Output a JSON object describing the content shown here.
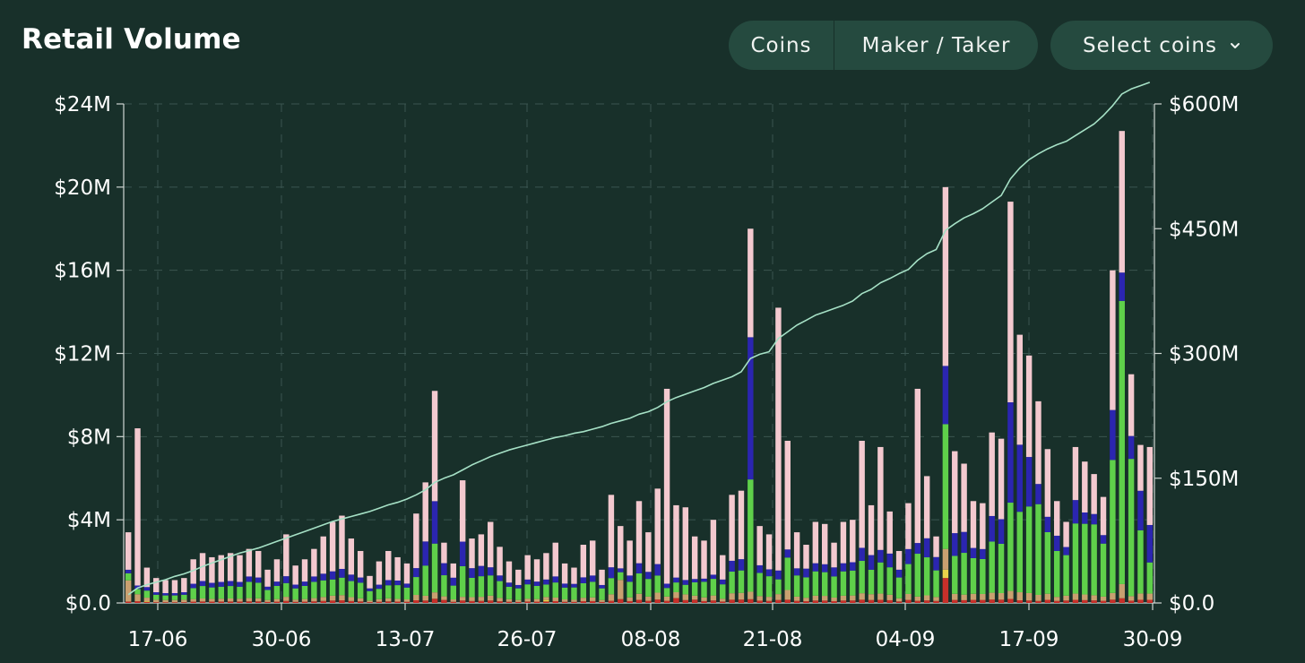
{
  "header": {
    "title": "Retail Volume",
    "toggle": [
      "Coins",
      "Maker / Taker"
    ],
    "select_label": "Select coins",
    "select_icon": "chevron-down-icon"
  },
  "chart_data": {
    "type": "bar",
    "stacked": true,
    "title": "Retail Volume",
    "grid": true,
    "x_ticks": [
      "17-06",
      "30-06",
      "13-07",
      "26-07",
      "08-08",
      "21-08",
      "04-09",
      "17-09",
      "30-09"
    ],
    "y_left": {
      "ticks": [
        "$0.0",
        "$4M",
        "$8M",
        "$12M",
        "$16M",
        "$20M",
        "$24M"
      ],
      "range": [
        0,
        24
      ]
    },
    "y_right": {
      "ticks": [
        "$0.0",
        "$150M",
        "$300M",
        "$450M",
        "$600M"
      ],
      "range": [
        0,
        600
      ]
    },
    "series_colors": [
      "#c8302a",
      "#e8d44a",
      "#c9a070",
      "#5fd04a",
      "#2b25b0",
      "#f3c9cf"
    ],
    "line_color": "#a6e1c6",
    "totals": [
      3.4,
      8.4,
      1.7,
      1.2,
      1.1,
      1.1,
      1.2,
      2.1,
      2.4,
      2.2,
      2.3,
      2.4,
      2.3,
      2.6,
      2.5,
      1.6,
      2.1,
      3.3,
      1.8,
      2.1,
      2.6,
      3.2,
      3.9,
      4.2,
      3.1,
      2.5,
      1.3,
      2.0,
      2.5,
      2.2,
      1.9,
      4.3,
      5.8,
      10.2,
      2.9,
      1.9,
      5.9,
      3.1,
      3.3,
      3.9,
      2.7,
      2.0,
      1.6,
      2.3,
      2.1,
      2.4,
      2.9,
      1.9,
      1.7,
      2.8,
      3.0,
      1.6,
      5.2,
      3.7,
      3.0,
      4.9,
      3.4,
      5.5,
      10.3,
      4.7,
      4.6,
      3.2,
      3.0,
      4.0,
      2.3,
      5.2,
      5.4,
      18.0,
      3.7,
      3.3,
      14.2,
      7.8,
      3.4,
      2.8,
      3.9,
      3.8,
      2.9,
      3.9,
      4.0,
      7.8,
      4.7,
      7.5,
      4.4,
      2.5,
      4.8,
      10.3,
      6.1,
      3.2,
      20.0,
      7.3,
      6.7,
      4.9,
      4.8,
      8.2,
      7.9,
      19.3,
      12.9,
      11.9,
      9.7,
      7.4,
      4.9,
      3.9,
      7.5,
      6.8,
      6.2,
      5.1,
      16.0,
      22.7,
      11.0,
      7.6,
      7.5
    ],
    "cumulative_right": [
      10,
      18,
      22,
      25,
      28,
      32,
      35,
      39,
      44,
      48,
      52,
      56,
      60,
      63,
      66,
      70,
      74,
      78,
      82,
      86,
      90,
      94,
      98,
      101,
      104,
      107,
      110,
      114,
      118,
      121,
      125,
      130,
      136,
      145,
      150,
      154,
      160,
      166,
      171,
      176,
      180,
      184,
      187,
      190,
      193,
      196,
      199,
      201,
      204,
      206,
      209,
      212,
      216,
      219,
      222,
      227,
      230,
      235,
      242,
      247,
      251,
      255,
      259,
      264,
      268,
      272,
      278,
      294,
      299,
      302,
      318,
      326,
      334,
      340,
      346,
      350,
      354,
      358,
      363,
      372,
      377,
      385,
      390,
      396,
      401,
      412,
      420,
      425,
      448,
      456,
      463,
      468,
      474,
      482,
      490,
      510,
      523,
      533,
      540,
      546,
      551,
      555,
      562,
      569,
      576,
      586,
      598,
      612,
      618,
      622,
      626
    ],
    "shares": {
      "red": [
        0.02,
        0.01,
        0.03,
        0.03,
        0.03,
        0.03,
        0.03,
        0.03,
        0.03,
        0.03,
        0.03,
        0.03,
        0.03,
        0.03,
        0.03,
        0.03,
        0.03,
        0.03,
        0.03,
        0.03,
        0.03,
        0.03,
        0.03,
        0.03,
        0.03,
        0.03,
        0.03,
        0.03,
        0.03,
        0.03,
        0.03,
        0.03,
        0.02,
        0.02,
        0.05,
        0.03,
        0.02,
        0.03,
        0.03,
        0.03,
        0.03,
        0.03,
        0.03,
        0.03,
        0.03,
        0.03,
        0.03,
        0.03,
        0.03,
        0.03,
        0.03,
        0.03,
        0.02,
        0.05,
        0.03,
        0.03,
        0.03,
        0.03,
        0.01,
        0.05,
        0.03,
        0.05,
        0.03,
        0.03,
        0.03,
        0.03,
        0.03,
        0.01,
        0.03,
        0.03,
        0.01,
        0.02,
        0.03,
        0.03,
        0.03,
        0.03,
        0.03,
        0.03,
        0.03,
        0.02,
        0.03,
        0.02,
        0.03,
        0.03,
        0.03,
        0.01,
        0.02,
        0.03,
        0.06,
        0.02,
        0.02,
        0.03,
        0.03,
        0.02,
        0.02,
        0.01,
        0.01,
        0.01,
        0.01,
        0.02,
        0.02,
        0.03,
        0.02,
        0.02,
        0.02,
        0.02,
        0.01,
        0.01,
        0.01,
        0.02,
        0.02
      ],
      "yellow": [
        0.0,
        0.0,
        0.02,
        0.0,
        0.0,
        0.0,
        0.0,
        0.0,
        0.0,
        0.0,
        0.0,
        0.0,
        0.0,
        0.0,
        0.0,
        0.0,
        0.0,
        0.0,
        0.0,
        0.0,
        0.0,
        0.0,
        0.0,
        0.0,
        0.0,
        0.0,
        0.0,
        0.0,
        0.0,
        0.0,
        0.0,
        0.0,
        0.0,
        0.0,
        0.0,
        0.0,
        0.0,
        0.0,
        0.0,
        0.0,
        0.0,
        0.0,
        0.0,
        0.0,
        0.0,
        0.03,
        0.0,
        0.0,
        0.0,
        0.0,
        0.0,
        0.0,
        0.0,
        0.0,
        0.0,
        0.0,
        0.0,
        0.0,
        0.0,
        0.0,
        0.0,
        0.0,
        0.0,
        0.0,
        0.0,
        0.0,
        0.0,
        0.0,
        0.0,
        0.0,
        0.0,
        0.0,
        0.0,
        0.0,
        0.0,
        0.0,
        0.0,
        0.0,
        0.0,
        0.0,
        0.0,
        0.0,
        0.0,
        0.0,
        0.0,
        0.0,
        0.0,
        0.0,
        0.02,
        0.0,
        0.0,
        0.0,
        0.0,
        0.0,
        0.0,
        0.0,
        0.0,
        0.0,
        0.0,
        0.0,
        0.0,
        0.0,
        0.0,
        0.0,
        0.0,
        0.0,
        0.0,
        0.0,
        0.0,
        0.0,
        0.0
      ],
      "tan": [
        0.3,
        0.04,
        0.1,
        0.1,
        0.1,
        0.1,
        0.1,
        0.06,
        0.06,
        0.06,
        0.06,
        0.06,
        0.06,
        0.06,
        0.06,
        0.06,
        0.06,
        0.06,
        0.06,
        0.06,
        0.06,
        0.06,
        0.06,
        0.06,
        0.06,
        0.06,
        0.06,
        0.06,
        0.06,
        0.06,
        0.06,
        0.06,
        0.04,
        0.03,
        0.06,
        0.06,
        0.03,
        0.06,
        0.06,
        0.06,
        0.06,
        0.06,
        0.06,
        0.06,
        0.06,
        0.06,
        0.06,
        0.06,
        0.06,
        0.06,
        0.06,
        0.06,
        0.06,
        0.25,
        0.06,
        0.06,
        0.06,
        0.06,
        0.02,
        0.06,
        0.06,
        0.06,
        0.06,
        0.06,
        0.06,
        0.06,
        0.06,
        0.02,
        0.06,
        0.06,
        0.02,
        0.06,
        0.06,
        0.06,
        0.06,
        0.06,
        0.06,
        0.06,
        0.06,
        0.04,
        0.06,
        0.04,
        0.06,
        0.06,
        0.06,
        0.02,
        0.04,
        0.06,
        0.05,
        0.04,
        0.04,
        0.06,
        0.06,
        0.04,
        0.04,
        0.02,
        0.03,
        0.03,
        0.03,
        0.04,
        0.04,
        0.06,
        0.04,
        0.04,
        0.04,
        0.04,
        0.02,
        0.03,
        0.02,
        0.04,
        0.04
      ],
      "green": [
        0.1,
        0.03,
        0.2,
        0.2,
        0.2,
        0.2,
        0.2,
        0.25,
        0.25,
        0.25,
        0.25,
        0.25,
        0.25,
        0.3,
        0.3,
        0.3,
        0.3,
        0.2,
        0.3,
        0.3,
        0.3,
        0.25,
        0.2,
        0.2,
        0.25,
        0.3,
        0.35,
        0.25,
        0.25,
        0.3,
        0.3,
        0.2,
        0.25,
        0.23,
        0.35,
        0.35,
        0.25,
        0.3,
        0.3,
        0.25,
        0.3,
        0.3,
        0.35,
        0.3,
        0.3,
        0.25,
        0.25,
        0.3,
        0.35,
        0.25,
        0.25,
        0.35,
        0.15,
        0.1,
        0.25,
        0.2,
        0.25,
        0.15,
        0.04,
        0.1,
        0.1,
        0.2,
        0.25,
        0.2,
        0.3,
        0.2,
        0.2,
        0.3,
        0.3,
        0.3,
        0.05,
        0.2,
        0.3,
        0.35,
        0.3,
        0.3,
        0.35,
        0.3,
        0.3,
        0.2,
        0.25,
        0.2,
        0.3,
        0.4,
        0.3,
        0.2,
        0.3,
        0.4,
        0.3,
        0.25,
        0.3,
        0.35,
        0.35,
        0.3,
        0.3,
        0.22,
        0.3,
        0.35,
        0.45,
        0.4,
        0.45,
        0.5,
        0.45,
        0.5,
        0.55,
        0.5,
        0.4,
        0.6,
        0.6,
        0.4,
        0.2
      ],
      "blue": [
        0.05,
        0.02,
        0.1,
        0.1,
        0.1,
        0.1,
        0.1,
        0.1,
        0.1,
        0.1,
        0.1,
        0.1,
        0.1,
        0.1,
        0.1,
        0.1,
        0.1,
        0.1,
        0.1,
        0.1,
        0.1,
        0.1,
        0.1,
        0.1,
        0.1,
        0.1,
        0.1,
        0.1,
        0.1,
        0.1,
        0.1,
        0.1,
        0.2,
        0.2,
        0.2,
        0.2,
        0.2,
        0.15,
        0.15,
        0.1,
        0.1,
        0.1,
        0.1,
        0.1,
        0.1,
        0.1,
        0.1,
        0.1,
        0.1,
        0.1,
        0.1,
        0.1,
        0.1,
        0.05,
        0.1,
        0.1,
        0.1,
        0.1,
        0.02,
        0.05,
        0.05,
        0.05,
        0.05,
        0.05,
        0.1,
        0.1,
        0.1,
        0.38,
        0.1,
        0.1,
        0.03,
        0.05,
        0.1,
        0.15,
        0.1,
        0.1,
        0.15,
        0.1,
        0.1,
        0.08,
        0.15,
        0.08,
        0.15,
        0.15,
        0.15,
        0.05,
        0.15,
        0.2,
        0.14,
        0.15,
        0.15,
        0.1,
        0.1,
        0.15,
        0.15,
        0.25,
        0.25,
        0.2,
        0.1,
        0.1,
        0.15,
        0.1,
        0.15,
        0.08,
        0.08,
        0.08,
        0.15,
        0.06,
        0.1,
        0.25,
        0.24
      ]
    }
  }
}
